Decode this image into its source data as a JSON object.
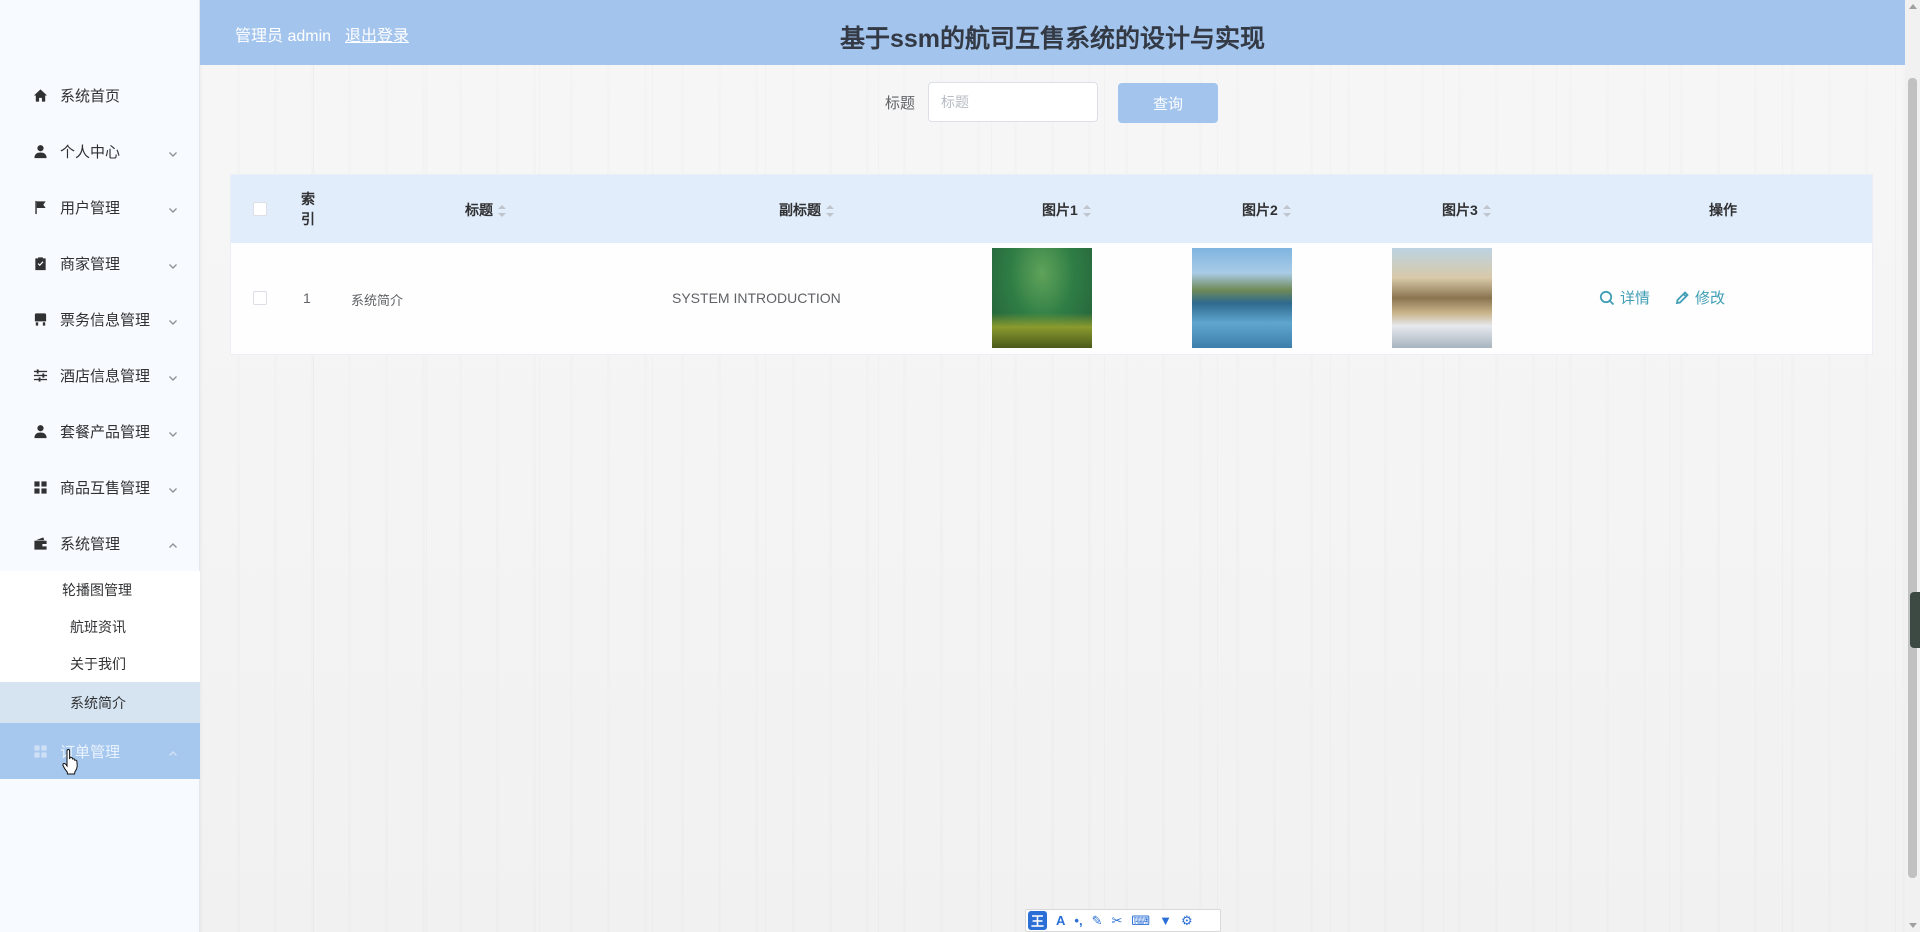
{
  "header": {
    "user_label": "管理员 admin",
    "logout_label": "退出登录",
    "title": "基于ssm的航司互售系统的设计与实现"
  },
  "sidebar": {
    "items": [
      {
        "label": "系统首页",
        "icon": "home-icon",
        "expandable": false
      },
      {
        "label": "个人中心",
        "icon": "user-icon",
        "expandable": true
      },
      {
        "label": "用户管理",
        "icon": "flag-icon",
        "expandable": true
      },
      {
        "label": "商家管理",
        "icon": "clipboard-check-icon",
        "expandable": true
      },
      {
        "label": "票务信息管理",
        "icon": "ticket-icon",
        "expandable": true
      },
      {
        "label": "酒店信息管理",
        "icon": "sliders-icon",
        "expandable": true
      },
      {
        "label": "套餐产品管理",
        "icon": "person-icon",
        "expandable": true
      },
      {
        "label": "商品互售管理",
        "icon": "grid-icon",
        "expandable": true
      },
      {
        "label": "系统管理",
        "icon": "wallet-icon",
        "expandable": true,
        "expanded": true
      }
    ],
    "sub_items": [
      "轮播图管理",
      "航班资讯",
      "关于我们",
      "系统简介"
    ],
    "active_sub": "系统简介",
    "last_item": {
      "label": "订单管理",
      "icon": "grid-icon"
    }
  },
  "search": {
    "label": "标题",
    "placeholder": "标题",
    "value": "",
    "button_label": "查询"
  },
  "table": {
    "columns": {
      "index": "索引",
      "title": "标题",
      "subtitle": "副标题",
      "pic1": "图片1",
      "pic2": "图片2",
      "pic3": "图片3",
      "actions": "操作"
    },
    "rows": [
      {
        "index": "1",
        "title": "系统简介",
        "subtitle": "SYSTEM INTRODUCTION",
        "pic1": "green-nature-image",
        "pic2": "mountain-lake-image",
        "pic3": "coast-waves-image"
      }
    ],
    "actions": {
      "detail_label": "详情",
      "edit_label": "修改"
    }
  },
  "colors": {
    "header_bg": "#a3c4ec",
    "table_head_bg": "#e2edfb",
    "action_text": "#409eb5",
    "active_submenu_bg": "#d6e4f2",
    "hover_menu_bg": "#a7c8ee"
  },
  "ime_toolbar": {
    "badge": "王",
    "letter": "A"
  }
}
